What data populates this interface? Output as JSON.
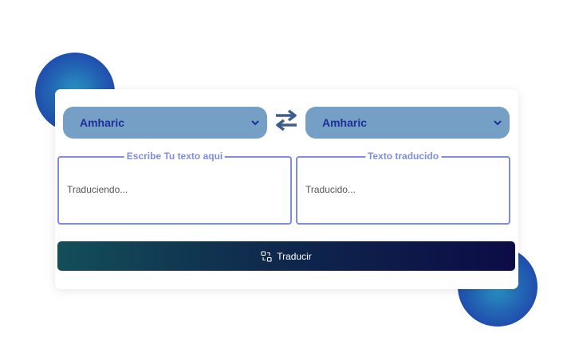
{
  "source_language": {
    "selected": "Amharic"
  },
  "target_language": {
    "selected": "Amharic"
  },
  "swap_button": {
    "icon": "swap-arrows-icon"
  },
  "source_panel": {
    "legend": "Escribe Tu texto aqui",
    "placeholder": "Traduciendo..."
  },
  "target_panel": {
    "legend": "Texto traducido",
    "placeholder": "Traducido..."
  },
  "translate_button": {
    "label": "Traducir",
    "icon": "translate-icon"
  },
  "colors": {
    "select_bg": "#759fc5",
    "select_text": "#1d2e9a",
    "border_accent": "#7e8ce2",
    "swap_icon": "#3e5b91",
    "button_gradient_start": "#134e59",
    "button_gradient_end": "#0c0c46",
    "blob": "#2365b4"
  }
}
